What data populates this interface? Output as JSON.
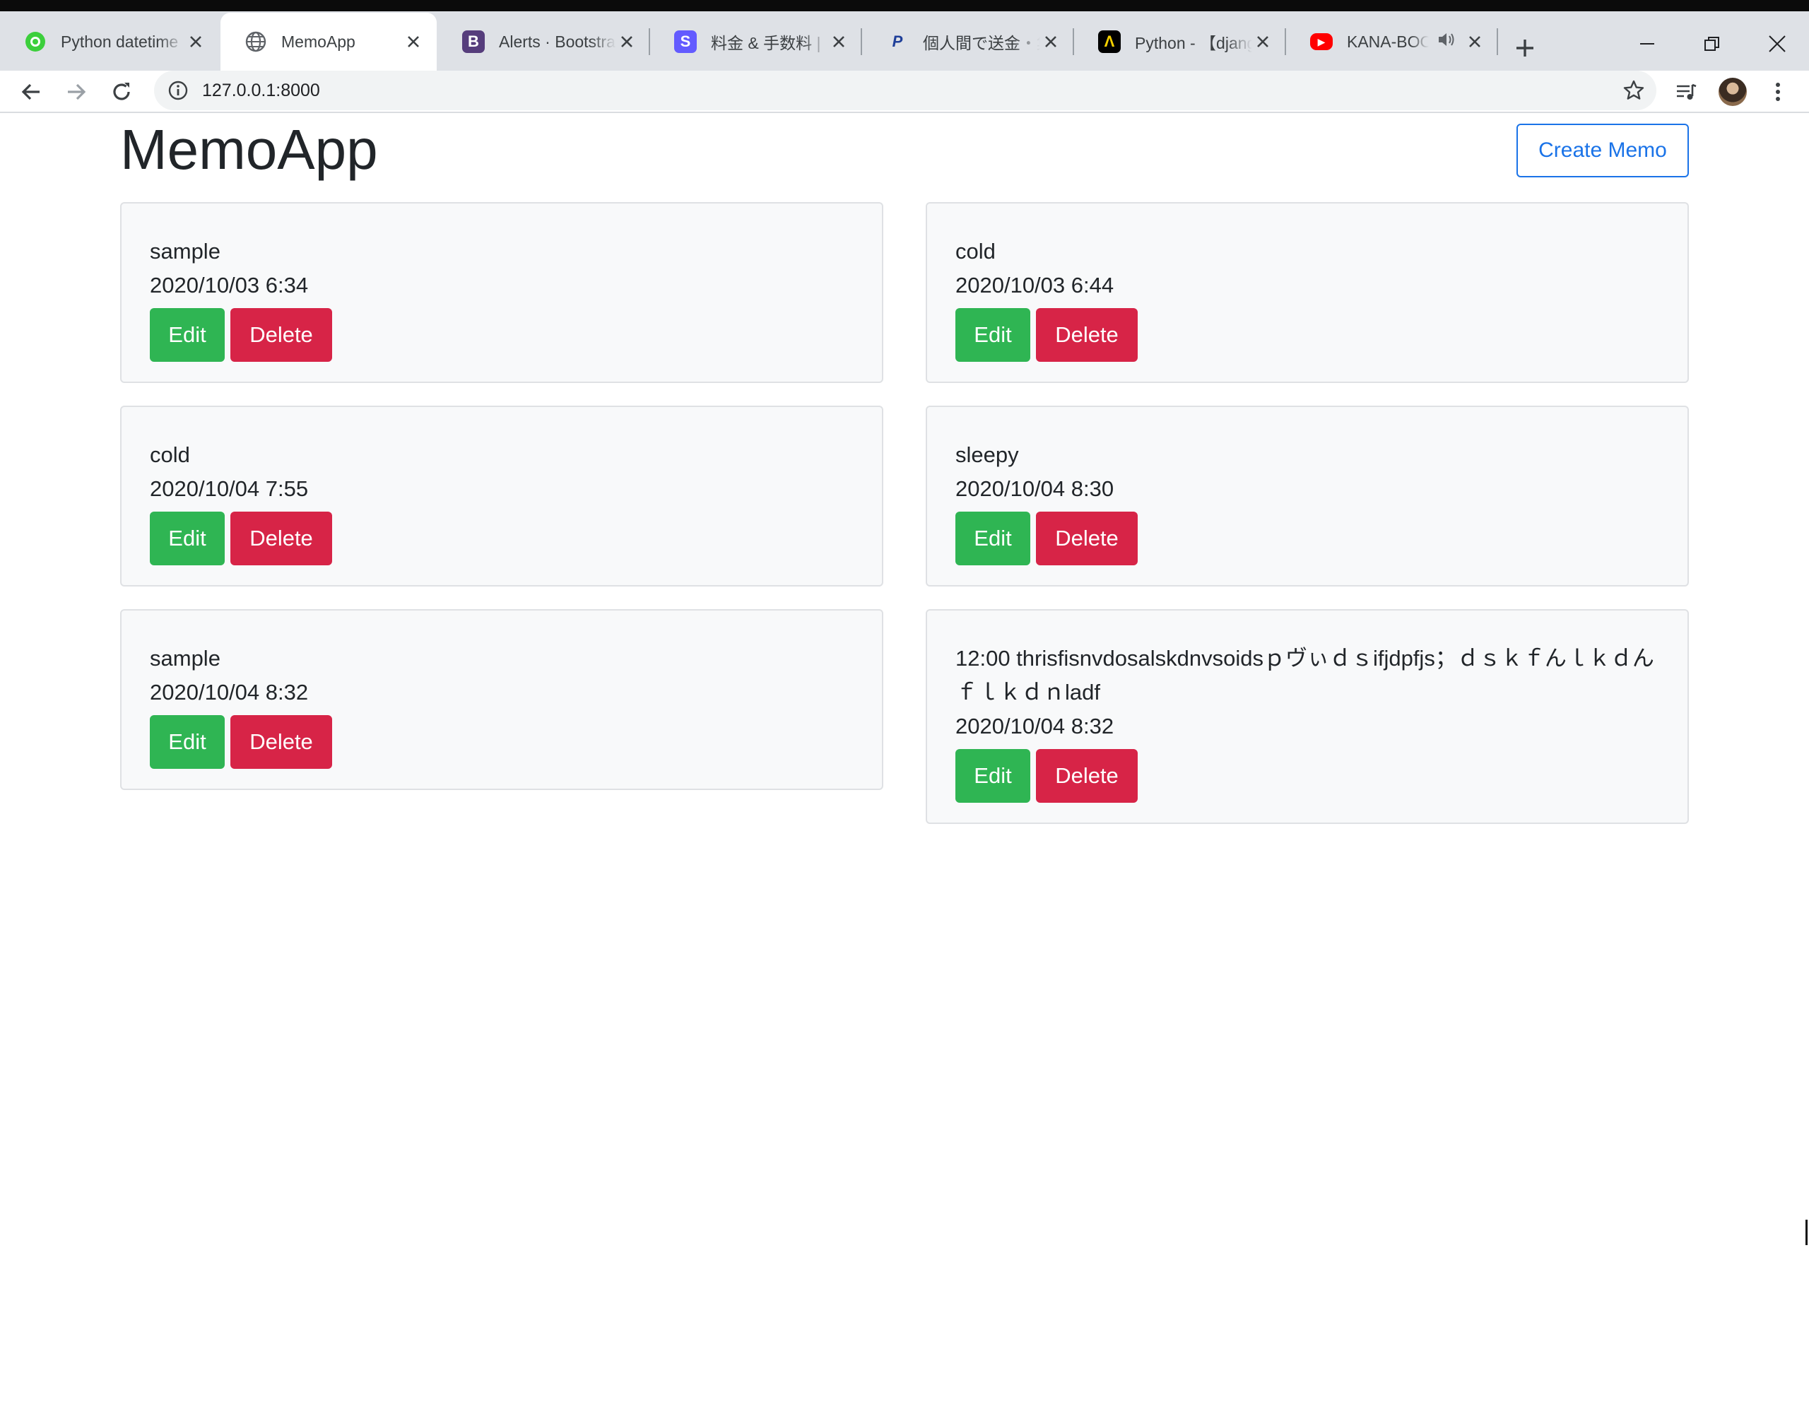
{
  "browser": {
    "tabs": [
      {
        "title": "Python datetime",
        "icon": "green-circle-icon",
        "color": "#3ccf3c",
        "glyph": "",
        "active": false,
        "audio": false
      },
      {
        "title": "MemoApp",
        "icon": "globe-icon",
        "color": "#5f6368",
        "glyph": "",
        "active": true,
        "audio": false
      },
      {
        "title": "Alerts · Bootstrap",
        "icon": "bootstrap-icon",
        "color": "#563d7c",
        "glyph": "B",
        "active": false,
        "audio": false
      },
      {
        "title": "料金 & 手数料 |",
        "icon": "stripe-icon",
        "color": "#635bff",
        "glyph": "S",
        "active": false,
        "audio": false
      },
      {
        "title": "個人間で送金・集",
        "icon": "paypal-icon",
        "color": "#ffffff",
        "glyph": "P",
        "active": false,
        "audio": false
      },
      {
        "title": "Python - 【django",
        "icon": "atcoder-icon",
        "color": "#000000",
        "glyph": "Λ",
        "active": false,
        "audio": false
      },
      {
        "title": "KANA-BOON",
        "icon": "youtube-icon",
        "color": "#ff0000",
        "glyph": "▶",
        "active": false,
        "audio": true
      }
    ],
    "new_tab_label": "+",
    "url": "127.0.0.1:8000"
  },
  "app": {
    "title": "MemoApp",
    "create_label": "Create Memo",
    "edit_label": "Edit",
    "delete_label": "Delete",
    "memos": [
      {
        "text": "sample",
        "date": "2020/10/03 6:34"
      },
      {
        "text": "cold",
        "date": "2020/10/03 6:44"
      },
      {
        "text": "cold",
        "date": "2020/10/04 7:55"
      },
      {
        "text": "sleepy",
        "date": "2020/10/04 8:30"
      },
      {
        "text": "sample",
        "date": "2020/10/04 8:32"
      },
      {
        "text": "12:00 thrisfisnvdosalskdnvsoidsｐヴぃｄｓifjdpfjs；ｄｓｋｆんｌｋｄんｆｌｋｄｎladf",
        "date": "2020/10/04 8:32"
      }
    ]
  },
  "colors": {
    "edit": "#2fb553",
    "delete": "#d72447",
    "primary_outline": "#1a73e8"
  }
}
